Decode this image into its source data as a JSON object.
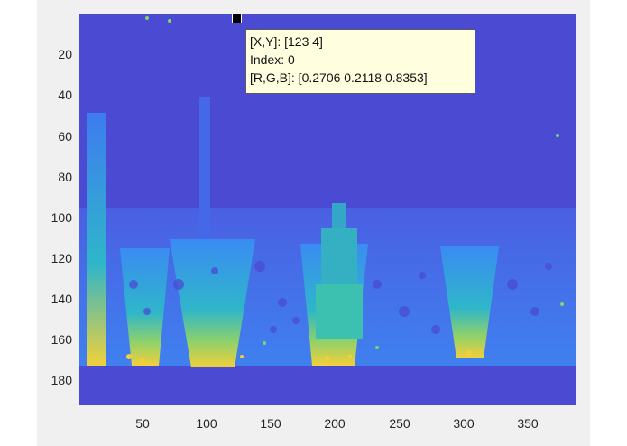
{
  "datatip": {
    "xy": "[X,Y]: [123 4]",
    "index": "Index: 0",
    "rgb": "[R,G,B]: [0.2706 0.2118 0.8353]"
  },
  "y_ticks": [
    "20",
    "40",
    "60",
    "80",
    "100",
    "120",
    "140",
    "160",
    "180"
  ],
  "x_ticks": [
    "50",
    "100",
    "150",
    "200",
    "250",
    "300",
    "350"
  ],
  "colors": {
    "background_plot": "#4a4bd2",
    "figure_bg": "#f0f0f0",
    "depth_low": "#3e7bf0",
    "depth_mid": "#2fb6c9",
    "depth_high": "#f3d03a"
  }
}
